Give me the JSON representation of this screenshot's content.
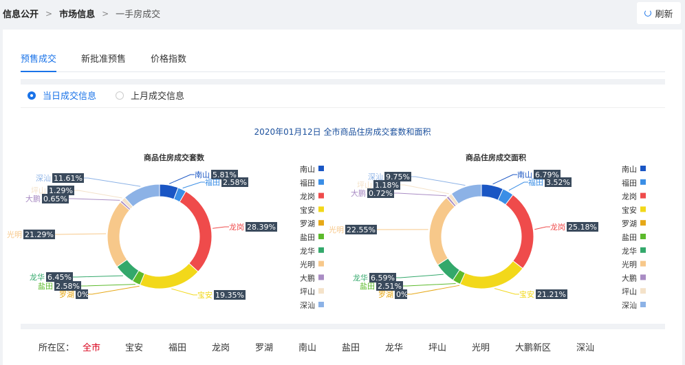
{
  "breadcrumb": [
    "信息公开",
    "市场信息",
    "一手房成交"
  ],
  "refresh_label": "刷新",
  "tabs": [
    {
      "label": "预售成交",
      "active": true
    },
    {
      "label": "新批准预售",
      "active": false
    },
    {
      "label": "价格指数",
      "active": false
    }
  ],
  "radios": [
    {
      "label": "当日成交信息",
      "active": true
    },
    {
      "label": "上月成交信息",
      "active": false
    }
  ],
  "district_filter": {
    "label": "所在区：",
    "items": [
      "全市",
      "宝安",
      "福田",
      "龙岗",
      "罗湖",
      "南山",
      "盐田",
      "龙华",
      "坪山",
      "光明",
      "大鹏新区",
      "深汕"
    ],
    "selected": "全市"
  },
  "colors": {
    "accent": "#1a73e8",
    "selected_district": "#d9001b"
  },
  "chart_data": [
    {
      "type": "pie",
      "title": "2020年01月12日 全市商品住房成交套数和面积",
      "subtitle": "商品住房成交套数",
      "categories": [
        "南山",
        "福田",
        "龙岗",
        "宝安",
        "罗湖",
        "盐田",
        "龙华",
        "光明",
        "大鹏",
        "坪山",
        "深汕"
      ],
      "values": [
        5.81,
        2.58,
        28.39,
        19.35,
        0,
        2.58,
        6.45,
        21.29,
        0.65,
        1.29,
        11.61
      ],
      "unit": "%",
      "colors": [
        "#1a56c4",
        "#3a8ee6",
        "#ef4b4b",
        "#f2d81a",
        "#e6a817",
        "#5cba2c",
        "#33a86b",
        "#f7c88a",
        "#a98cc4",
        "#f4e2c9",
        "#8cb2e6"
      ],
      "legend": "right"
    },
    {
      "type": "pie",
      "subtitle": "商品住房成交面积",
      "categories": [
        "南山",
        "福田",
        "龙岗",
        "宝安",
        "罗湖",
        "盐田",
        "龙华",
        "光明",
        "大鹏",
        "坪山",
        "深汕"
      ],
      "values": [
        6.79,
        3.52,
        25.18,
        21.21,
        0,
        2.51,
        6.59,
        22.55,
        0.72,
        1.18,
        9.75
      ],
      "unit": "%",
      "colors": [
        "#1a56c4",
        "#3a8ee6",
        "#ef4b4b",
        "#f2d81a",
        "#e6a817",
        "#5cba2c",
        "#33a86b",
        "#f7c88a",
        "#a98cc4",
        "#f4e2c9",
        "#8cb2e6"
      ],
      "legend": "right"
    }
  ]
}
